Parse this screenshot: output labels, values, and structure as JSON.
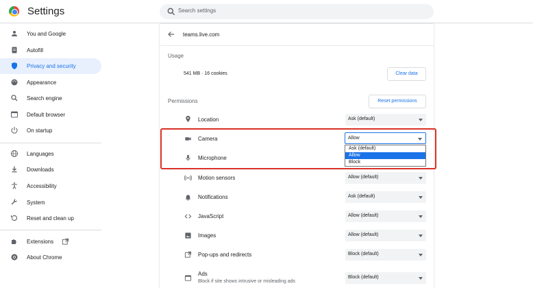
{
  "app": {
    "title": "Settings"
  },
  "search": {
    "placeholder": "Search settings"
  },
  "sidebar": {
    "items": [
      {
        "label": "You and Google",
        "icon": "person-icon"
      },
      {
        "label": "Autofill",
        "icon": "autofill-icon"
      },
      {
        "label": "Privacy and security",
        "icon": "shield-icon",
        "active": true
      },
      {
        "label": "Appearance",
        "icon": "palette-icon"
      },
      {
        "label": "Search engine",
        "icon": "search-icon"
      },
      {
        "label": "Default browser",
        "icon": "browser-icon"
      },
      {
        "label": "On startup",
        "icon": "power-icon"
      },
      {
        "label": "Languages",
        "icon": "globe-icon"
      },
      {
        "label": "Downloads",
        "icon": "download-icon"
      },
      {
        "label": "Accessibility",
        "icon": "accessibility-icon"
      },
      {
        "label": "System",
        "icon": "wrench-icon"
      },
      {
        "label": "Reset and clean up",
        "icon": "restore-icon"
      },
      {
        "label": "Extensions",
        "icon": "puzzle-icon"
      },
      {
        "label": "About Chrome",
        "icon": "chrome-icon"
      }
    ]
  },
  "site": {
    "name": "teams.live.com",
    "usage_heading": "Usage",
    "usage_value": "541 MB · 16 cookies",
    "clear_label": "Clear data",
    "permissions_heading": "Permissions",
    "reset_label": "Reset permissions"
  },
  "permissions": [
    {
      "label": "Location",
      "value": "Ask (default)",
      "icon": "location-pin-icon"
    },
    {
      "label": "Camera",
      "value": "Allow",
      "icon": "camera-icon"
    },
    {
      "label": "Microphone",
      "value": "",
      "icon": "microphone-icon"
    },
    {
      "label": "Motion sensors",
      "value": "Allow (default)",
      "icon": "motion-sensor-icon"
    },
    {
      "label": "Notifications",
      "value": "Ask (default)",
      "icon": "bell-icon"
    },
    {
      "label": "JavaScript",
      "value": "Allow (default)",
      "icon": "code-icon"
    },
    {
      "label": "Images",
      "value": "Allow (default)",
      "icon": "image-icon"
    },
    {
      "label": "Pop-ups and redirects",
      "value": "Block (default)",
      "icon": "popup-icon"
    },
    {
      "label": "Ads",
      "sublabel": "Block if site shows intrusive or misleading ads",
      "value": "Block (default)",
      "icon": "ads-icon"
    }
  ],
  "camera_dropdown": {
    "options": [
      "Ask (default)",
      "Allow",
      "Block"
    ],
    "selected": "Allow"
  },
  "colors": {
    "accent": "#1a73e8",
    "highlight": "#d93025",
    "active_bg": "#e8f0fe"
  }
}
